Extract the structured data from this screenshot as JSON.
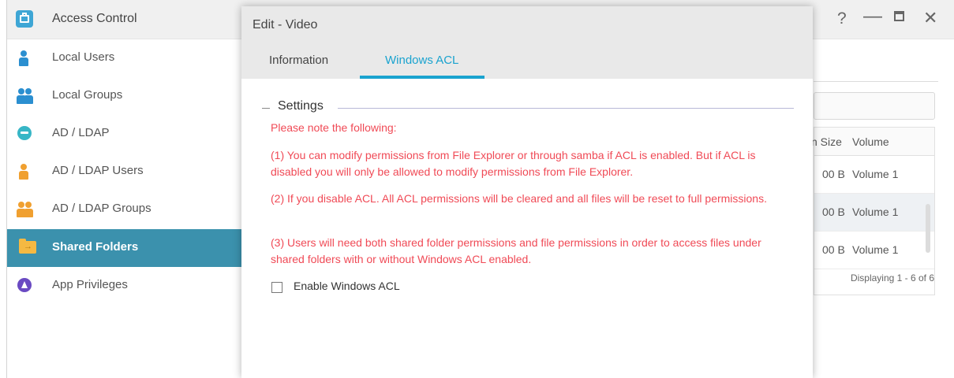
{
  "window": {
    "title": "Access Control",
    "help_glyph": "?",
    "minimize_glyph": "—",
    "close_glyph": "✕"
  },
  "sidebar": {
    "items": [
      {
        "label": "Local Users",
        "icon": "user-icon"
      },
      {
        "label": "Local Groups",
        "icon": "group-icon"
      },
      {
        "label": "AD / LDAP",
        "icon": "key-icon"
      },
      {
        "label": "AD / LDAP Users",
        "icon": "user-icon"
      },
      {
        "label": "AD / LDAP Groups",
        "icon": "group-icon"
      },
      {
        "label": "Shared Folders",
        "icon": "shared-folder-icon",
        "active": true
      },
      {
        "label": "App Privileges",
        "icon": "app-privileges-icon"
      }
    ]
  },
  "right_list": {
    "col_size": "n Size",
    "col_volume": "Volume",
    "rows": [
      {
        "size": "00 B",
        "volume": "Volume 1"
      },
      {
        "size": "00 B",
        "volume": "Volume 1"
      },
      {
        "size": "00 B",
        "volume": "Volume 1"
      }
    ],
    "footer": "Displaying 1 - 6 of 6"
  },
  "modal": {
    "title": "Edit - Video",
    "tabs": [
      "Information",
      "Windows ACL"
    ],
    "active_tab": "Windows ACL",
    "section_title": "Settings",
    "notes": {
      "intro": "Please note the following:",
      "n1": "(1) You can modify permissions from File Explorer or through samba if ACL is enabled. But if ACL is disabled you will only be allowed to modify permissions from File Explorer.",
      "n2": "(2) If you disable ACL. All ACL permissions will be cleared and all files will be reset to full permissions.",
      "n3": "(3) Users will need both shared folder permissions and file permissions in order to access files under shared folders with or without Windows ACL enabled."
    },
    "checkbox_label": "Enable Windows ACL",
    "checkbox_checked": false
  },
  "colors": {
    "accent": "#1aa3cf",
    "sidebar_active": "#3b91ad",
    "warning_text": "#f04a56"
  }
}
